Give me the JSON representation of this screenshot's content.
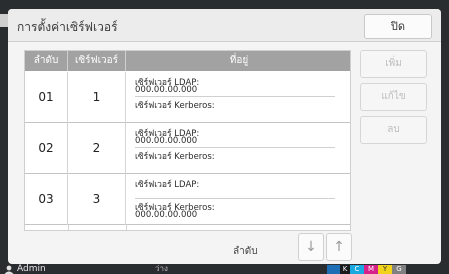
{
  "dialog": {
    "title": "การตั้งค่าเซิร์ฟเวอร์",
    "close_label": "ปิด"
  },
  "table": {
    "headers": [
      "ลำดับ",
      "เซิร์ฟเวอร์",
      "ที่อยู่"
    ],
    "rows": [
      {
        "order": "01",
        "server": "1",
        "ldap_label": "เซิร์ฟเวอร์ LDAP:",
        "ldap_value": "000.00.00.000",
        "kerberos_label": "เซิร์ฟเวอร์ Kerberos:",
        "kerberos_value": ""
      },
      {
        "order": "02",
        "server": "2",
        "ldap_label": "เซิร์ฟเวอร์ LDAP:",
        "ldap_value": "000.00.00.000",
        "kerberos_label": "เซิร์ฟเวอร์ Kerberos:",
        "kerberos_value": ""
      },
      {
        "order": "03",
        "server": "3",
        "ldap_label": "เซิร์ฟเวอร์ LDAP:",
        "ldap_value": "",
        "kerberos_label": "เซิร์ฟเวอร์ Kerberos:",
        "kerberos_value": "000.00.00.000"
      }
    ]
  },
  "side_buttons": {
    "add": "เพิ่ม",
    "edit": "แก้ไข",
    "delete": "ลบ"
  },
  "order_control": {
    "label": "ลำดับ",
    "down_icon": "↓",
    "up_icon": "↑"
  },
  "status_bar": {
    "user": "Admin",
    "status": "ว่าง",
    "inks": [
      "K",
      "C",
      "M",
      "Y",
      "G"
    ],
    "ink_colors": {
      "K": "#1a1a1a",
      "C": "#19a9e0",
      "M": "#d6208a",
      "Y": "#f2d31c",
      "G": "#808080"
    }
  }
}
